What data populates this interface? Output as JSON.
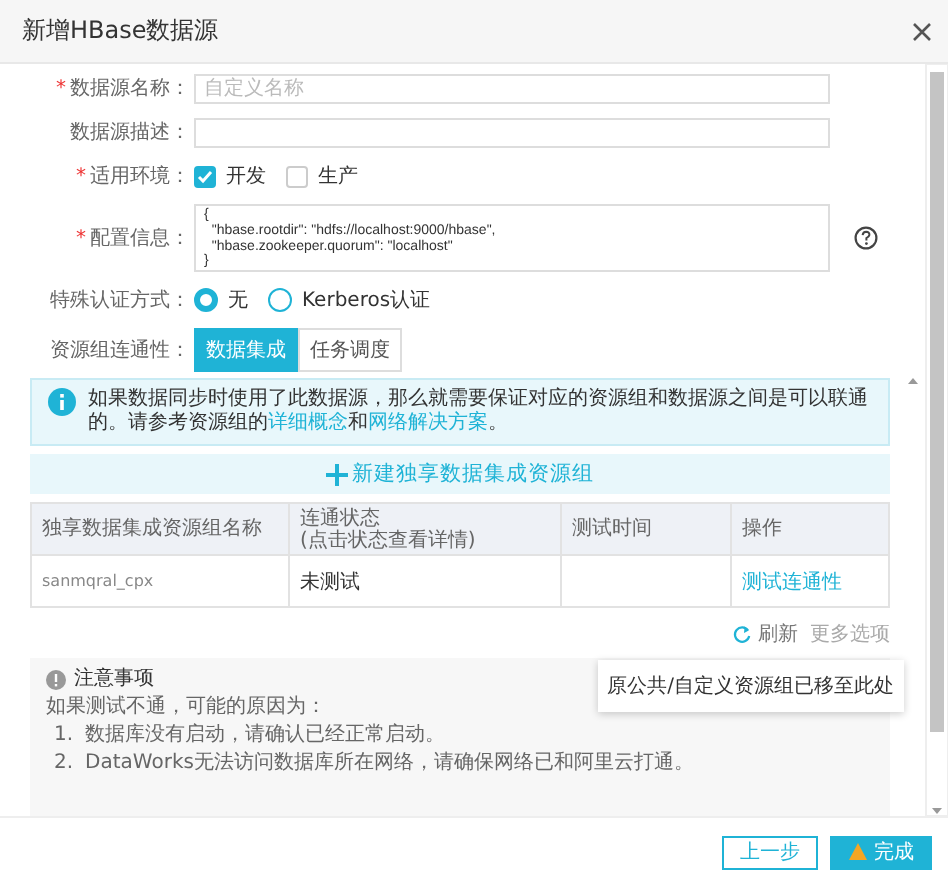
{
  "window": {
    "title": "新增HBase数据源"
  },
  "form": {
    "required_mark": "*",
    "fields": [
      {
        "kind": "input",
        "label": "数据源名称：",
        "required": true,
        "placeholder": "自定义名称"
      },
      {
        "kind": "input",
        "label": "数据源描述：",
        "required": false
      },
      {
        "kind": "checkboxes",
        "label": "适用环境：",
        "required": true,
        "options": [
          {
            "label": "开发",
            "checked": true
          },
          {
            "label": "生产",
            "checked": false
          }
        ]
      },
      {
        "kind": "textarea",
        "label": "配置信息：",
        "required": true,
        "value": "{\n  \"hbase.rootdir\": \"hdfs://localhost:9000/hbase\",\n  \"hbase.zookeeper.quorum\": \"localhost\"\n}",
        "help": true
      },
      {
        "kind": "radios",
        "label": "特殊认证方式：",
        "required": false,
        "options": [
          {
            "label": "无",
            "selected": true
          },
          {
            "label": "Kerberos认证",
            "selected": false
          }
        ]
      },
      {
        "kind": "segmented",
        "label": "资源组连通性：",
        "required": false,
        "options": [
          {
            "label": "数据集成",
            "selected": true
          },
          {
            "label": "任务调度",
            "selected": false
          }
        ]
      }
    ]
  },
  "info": {
    "segments": [
      {
        "text": "如果数据同步时使用了此数据源，那么就需要保证对应的资源组和数据源之间是可以联通的。请参考资源组的",
        "link": false
      },
      {
        "text": "详细概念",
        "link": true
      },
      {
        "text": "和",
        "link": false
      },
      {
        "text": "网络解决方案",
        "link": true
      },
      {
        "text": "。",
        "link": false
      }
    ]
  },
  "add_button": {
    "label": "新建独享数据集成资源组"
  },
  "table": {
    "columns": [
      "独享数据集成资源组名称",
      "连通状态\n(点击状态查看详情)",
      "测试时间",
      "操作"
    ],
    "rows": [
      {
        "name": "sanmqral_cpx",
        "status": "未测试",
        "action": "测试连通性"
      }
    ]
  },
  "table_actions": {
    "refresh": "刷新",
    "more": "更多选项"
  },
  "tooltip": "原公共/自定义资源组已移至此处",
  "notes": {
    "title": "注意事项",
    "intro": "如果测试不通，可能的原因为：",
    "items": [
      {
        "number": "1.",
        "text": "数据库没有启动，请确认已经正常启动。"
      },
      {
        "number": "2.",
        "text": "DataWorks无法访问数据库所在网络，请确保网络已和阿里云打通。"
      }
    ]
  },
  "footer": {
    "buttons": [
      {
        "label": "上一步",
        "kind": "secondary"
      },
      {
        "label": "完成",
        "kind": "primary"
      }
    ]
  }
}
